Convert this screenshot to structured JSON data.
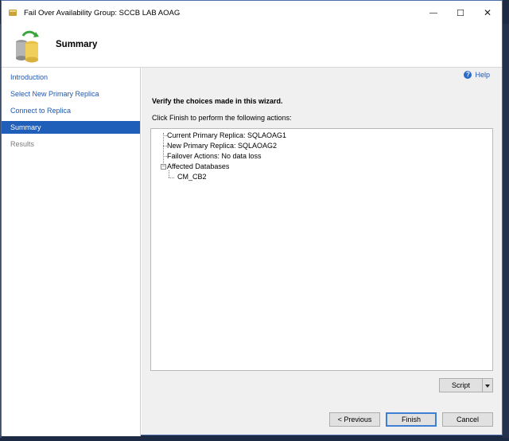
{
  "window": {
    "title": "Fail Over Availability Group: SCCB LAB AOAG",
    "controls": {
      "minimize": "—",
      "maximize": "☐",
      "close": "✕"
    }
  },
  "header": {
    "title": "Summary"
  },
  "nav": {
    "items": [
      {
        "label": "Introduction",
        "state": "link"
      },
      {
        "label": "Select New Primary Replica",
        "state": "link"
      },
      {
        "label": "Connect to Replica",
        "state": "link"
      },
      {
        "label": "Summary",
        "state": "active"
      },
      {
        "label": "Results",
        "state": "disabled"
      }
    ]
  },
  "main": {
    "help_label": "Help",
    "verify_text": "Verify the choices made in this wizard.",
    "instruction_text": "Click Finish to perform the following actions:",
    "tree": {
      "items": [
        "Current Primary Replica: SQLAOAG1",
        "New Primary Replica: SQLAOAG2",
        "Failover Actions: No data loss",
        "Affected Databases"
      ],
      "child": "CM_CB2"
    }
  },
  "buttons": {
    "script": "Script",
    "previous": "< Previous",
    "finish": "Finish",
    "cancel": "Cancel"
  },
  "colors": {
    "accent": "#1f5fb9",
    "link": "#1f57b0",
    "panel": "#f0f0f0"
  }
}
